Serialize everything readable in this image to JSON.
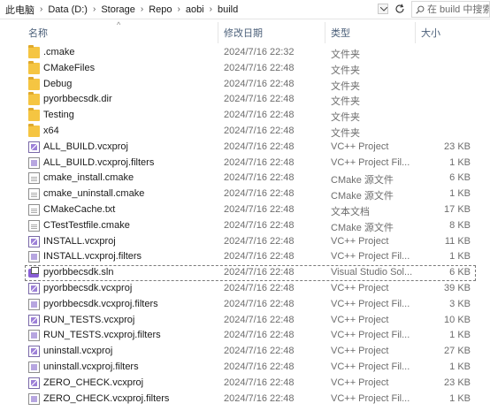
{
  "breadcrumb": [
    "此电脑",
    "Data (D:)",
    "Storage",
    "Repo",
    "aobi",
    "build"
  ],
  "search": {
    "placeholder": "在 build 中搜索"
  },
  "columns": {
    "name": "名称",
    "date": "修改日期",
    "type": "类型",
    "size": "大小"
  },
  "files": [
    {
      "name": ".cmake",
      "date": "2024/7/16 22:32",
      "type": "文件夹",
      "size": "",
      "icon": "folder-icon"
    },
    {
      "name": "CMakeFiles",
      "date": "2024/7/16 22:48",
      "type": "文件夹",
      "size": "",
      "icon": "folder-icon"
    },
    {
      "name": "Debug",
      "date": "2024/7/16 22:48",
      "type": "文件夹",
      "size": "",
      "icon": "folder-icon"
    },
    {
      "name": "pyorbbecsdk.dir",
      "date": "2024/7/16 22:48",
      "type": "文件夹",
      "size": "",
      "icon": "folder-icon"
    },
    {
      "name": "Testing",
      "date": "2024/7/16 22:48",
      "type": "文件夹",
      "size": "",
      "icon": "folder-icon"
    },
    {
      "name": "x64",
      "date": "2024/7/16 22:48",
      "type": "文件夹",
      "size": "",
      "icon": "folder-icon"
    },
    {
      "name": "ALL_BUILD.vcxproj",
      "date": "2024/7/16 22:48",
      "type": "VC++ Project",
      "size": "23 KB",
      "icon": "vcxproj-icon"
    },
    {
      "name": "ALL_BUILD.vcxproj.filters",
      "date": "2024/7/16 22:48",
      "type": "VC++ Project Fil...",
      "size": "1 KB",
      "icon": "filters-icon"
    },
    {
      "name": "cmake_install.cmake",
      "date": "2024/7/16 22:48",
      "type": "CMake 源文件",
      "size": "6 KB",
      "icon": "document-icon"
    },
    {
      "name": "cmake_uninstall.cmake",
      "date": "2024/7/16 22:48",
      "type": "CMake 源文件",
      "size": "1 KB",
      "icon": "document-icon"
    },
    {
      "name": "CMakeCache.txt",
      "date": "2024/7/16 22:48",
      "type": "文本文档",
      "size": "17 KB",
      "icon": "document-icon"
    },
    {
      "name": "CTestTestfile.cmake",
      "date": "2024/7/16 22:48",
      "type": "CMake 源文件",
      "size": "8 KB",
      "icon": "document-icon"
    },
    {
      "name": "INSTALL.vcxproj",
      "date": "2024/7/16 22:48",
      "type": "VC++ Project",
      "size": "11 KB",
      "icon": "vcxproj-icon"
    },
    {
      "name": "INSTALL.vcxproj.filters",
      "date": "2024/7/16 22:48",
      "type": "VC++ Project Fil...",
      "size": "1 KB",
      "icon": "filters-icon"
    },
    {
      "name": "pyorbbecsdk.sln",
      "date": "2024/7/16 22:48",
      "type": "Visual Studio Sol...",
      "size": "6 KB",
      "icon": "solution-icon",
      "selected": true
    },
    {
      "name": "pyorbbecsdk.vcxproj",
      "date": "2024/7/16 22:48",
      "type": "VC++ Project",
      "size": "39 KB",
      "icon": "vcxproj-icon"
    },
    {
      "name": "pyorbbecsdk.vcxproj.filters",
      "date": "2024/7/16 22:48",
      "type": "VC++ Project Fil...",
      "size": "3 KB",
      "icon": "filters-icon"
    },
    {
      "name": "RUN_TESTS.vcxproj",
      "date": "2024/7/16 22:48",
      "type": "VC++ Project",
      "size": "10 KB",
      "icon": "vcxproj-icon"
    },
    {
      "name": "RUN_TESTS.vcxproj.filters",
      "date": "2024/7/16 22:48",
      "type": "VC++ Project Fil...",
      "size": "1 KB",
      "icon": "filters-icon"
    },
    {
      "name": "uninstall.vcxproj",
      "date": "2024/7/16 22:48",
      "type": "VC++ Project",
      "size": "27 KB",
      "icon": "vcxproj-icon"
    },
    {
      "name": "uninstall.vcxproj.filters",
      "date": "2024/7/16 22:48",
      "type": "VC++ Project Fil...",
      "size": "1 KB",
      "icon": "filters-icon"
    },
    {
      "name": "ZERO_CHECK.vcxproj",
      "date": "2024/7/16 22:48",
      "type": "VC++ Project",
      "size": "23 KB",
      "icon": "vcxproj-icon"
    },
    {
      "name": "ZERO_CHECK.vcxproj.filters",
      "date": "2024/7/16 22:48",
      "type": "VC++ Project Fil...",
      "size": "1 KB",
      "icon": "filters-icon"
    }
  ]
}
